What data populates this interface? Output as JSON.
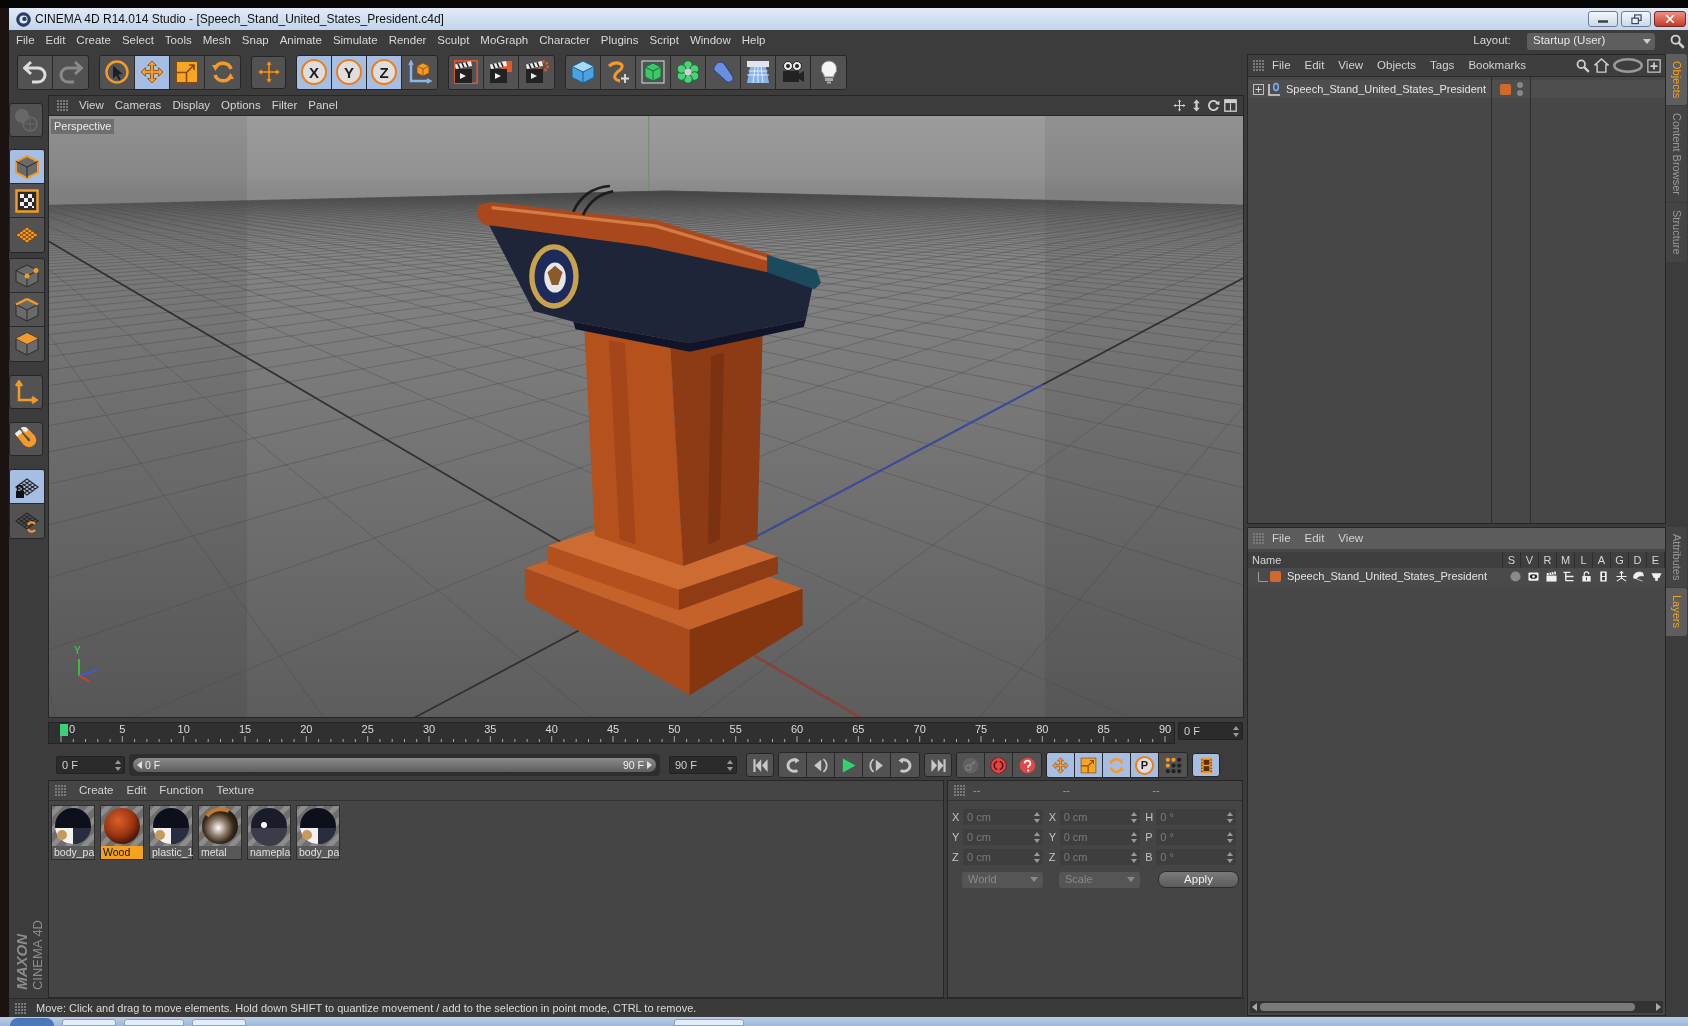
{
  "window": {
    "title": "CINEMA 4D R14.014 Studio - [Speech_Stand_United_States_President.c4d]"
  },
  "menu_bar": {
    "items": [
      "File",
      "Edit",
      "Create",
      "Select",
      "Tools",
      "Mesh",
      "Snap",
      "Animate",
      "Simulate",
      "Render",
      "Sculpt",
      "MoGraph",
      "Character",
      "Plugins",
      "Script",
      "Window",
      "Help"
    ],
    "layout_label": "Layout:",
    "layout_value": "Startup (User)"
  },
  "toolbar": [
    {
      "buttons": [
        {
          "kind": "undo",
          "disabled": false
        },
        {
          "kind": "redo",
          "disabled": true
        }
      ]
    },
    {
      "buttons": [
        {
          "kind": "live_select",
          "selected": false
        },
        {
          "kind": "move",
          "selected": true
        },
        {
          "kind": "scale",
          "selected": false
        },
        {
          "kind": "rotate",
          "selected": false
        }
      ]
    },
    {
      "buttons": [
        {
          "kind": "recent_tool"
        }
      ]
    },
    {
      "buttons": [
        {
          "kind": "axis",
          "label": "X",
          "on": true
        },
        {
          "kind": "axis",
          "label": "Y",
          "on": true
        },
        {
          "kind": "axis",
          "label": "Z",
          "on": true
        },
        {
          "kind": "coordinate_system",
          "on": false
        }
      ]
    },
    {
      "buttons": [
        {
          "kind": "render_view"
        },
        {
          "kind": "render_picture_viewer"
        },
        {
          "kind": "render_settings"
        }
      ]
    },
    {
      "buttons": [
        {
          "kind": "cube"
        },
        {
          "kind": "spline_pen"
        },
        {
          "kind": "subdivision_surface"
        },
        {
          "kind": "cloner"
        },
        {
          "kind": "bend_deformer"
        },
        {
          "kind": "floor"
        },
        {
          "kind": "camera"
        },
        {
          "kind": "light"
        }
      ]
    }
  ],
  "mode_toolbar": [
    {
      "buttons": [
        {
          "kind": "make_editable",
          "disabled": true
        }
      ]
    },
    {
      "buttons": [
        {
          "kind": "model",
          "selected": true
        },
        {
          "kind": "texture",
          "selected": false
        },
        {
          "kind": "workplane",
          "selected": false
        }
      ]
    },
    {
      "buttons": [
        {
          "kind": "points",
          "selected": false
        },
        {
          "kind": "edges",
          "selected": false
        },
        {
          "kind": "polygons",
          "selected": false
        }
      ]
    },
    {
      "buttons": [
        {
          "kind": "axis_mode",
          "selected": false
        }
      ]
    },
    {
      "buttons": [
        {
          "kind": "tweak",
          "selected": false
        }
      ]
    },
    {
      "buttons": [
        {
          "kind": "locked_workplane",
          "on": true
        },
        {
          "kind": "planar_workplane",
          "on": false
        }
      ]
    }
  ],
  "viewport": {
    "menu": [
      "View",
      "Cameras",
      "Display",
      "Options",
      "Filter",
      "Panel"
    ],
    "camera_label": "Perspective",
    "gizmo_label": "Y"
  },
  "timeline": {
    "ruler_labels": [
      "0",
      "5",
      "10",
      "15",
      "20",
      "25",
      "30",
      "35",
      "40",
      "45",
      "50",
      "55",
      "60",
      "65",
      "70",
      "75",
      "80",
      "85",
      "90"
    ],
    "playhead": {
      "level": 0
    },
    "current_frame": "0 F"
  },
  "playback": {
    "start_frame": "0 F",
    "range": {
      "start": "0 F",
      "end": "90 F",
      "level": 1
    },
    "end_frame": "90 F",
    "groups": [
      {
        "buttons": [
          {
            "kind": "to_start"
          }
        ]
      },
      {
        "buttons": [
          {
            "kind": "prev_key"
          },
          {
            "kind": "prev_frame"
          },
          {
            "kind": "play"
          },
          {
            "kind": "next_frame"
          },
          {
            "kind": "next_key"
          }
        ]
      },
      {
        "buttons": [
          {
            "kind": "to_end"
          }
        ]
      },
      {
        "buttons": [
          {
            "kind": "record_keys",
            "disabled": true
          },
          {
            "kind": "autokey",
            "disabled": false
          },
          {
            "kind": "keyframe_selection",
            "disabled": false
          }
        ]
      },
      {
        "buttons": [
          {
            "kind": "key_position",
            "on": true
          },
          {
            "kind": "key_scale",
            "on": true
          },
          {
            "kind": "key_rotation",
            "on": true
          },
          {
            "kind": "key_parameter",
            "label": "P",
            "on": true
          },
          {
            "kind": "key_point_level",
            "on": false
          }
        ]
      },
      {
        "buttons": [
          {
            "kind": "timeline_window",
            "on": true
          }
        ]
      }
    ]
  },
  "materials": {
    "menu": [
      "Create",
      "Edit",
      "Function",
      "Texture"
    ],
    "items": [
      {
        "name": "body_pa",
        "kind": "dark",
        "selected": false
      },
      {
        "name": "Wood",
        "kind": "wood",
        "selected": true
      },
      {
        "name": "plastic_1",
        "kind": "dark",
        "selected": false
      },
      {
        "name": "metal",
        "kind": "metal",
        "selected": false
      },
      {
        "name": "namepla",
        "kind": "glossy",
        "selected": false
      },
      {
        "name": "body_pa",
        "kind": "dark",
        "selected": false
      }
    ]
  },
  "branding": {
    "vendor": "MAXON",
    "product": "CINEMA 4D"
  },
  "coordinates": {
    "disabled": true,
    "columns": [
      {
        "header": "--",
        "fields": [
          {
            "axis": "X",
            "value": "0 cm"
          },
          {
            "axis": "Y",
            "value": "0 cm"
          },
          {
            "axis": "Z",
            "value": "0 cm"
          }
        ]
      },
      {
        "header": "--",
        "fields": [
          {
            "axis": "X",
            "value": "0 cm"
          },
          {
            "axis": "Y",
            "value": "0 cm"
          },
          {
            "axis": "Z",
            "value": "0 cm"
          }
        ]
      },
      {
        "header": "--",
        "fields": [
          {
            "axis": "H",
            "value": "0 °"
          },
          {
            "axis": "P",
            "value": "0 °"
          },
          {
            "axis": "B",
            "value": "0 °"
          }
        ]
      }
    ],
    "space": "World",
    "mode": "Scale",
    "apply_label": "Apply"
  },
  "status_bar": {
    "text": "Move: Click and drag to move elements. Hold down SHIFT to quantize movement / add to the selection in point mode, CTRL to remove."
  },
  "object_manager": {
    "menu": [
      "File",
      "Edit",
      "View",
      "Objects",
      "Tags",
      "Bookmarks"
    ],
    "objects": [
      {
        "name": "Speech_Stand_United_States_President",
        "expanded": false,
        "color": "#d2692a"
      }
    ]
  },
  "layer_manager": {
    "menu": [
      "File",
      "Edit",
      "View"
    ],
    "columns": [
      "Name",
      "S",
      "V",
      "R",
      "M",
      "L",
      "A",
      "G",
      "D",
      "E"
    ],
    "layers": [
      {
        "name": "Speech_Stand_United_States_President",
        "color": "#d2692a",
        "toggles": [
          {
            "kind": "solo",
            "on": false
          },
          {
            "kind": "visible",
            "on": true
          },
          {
            "kind": "render",
            "on": true
          },
          {
            "kind": "manager",
            "on": true
          },
          {
            "kind": "locked",
            "on": true
          },
          {
            "kind": "animation",
            "on": true
          },
          {
            "kind": "generators",
            "on": true
          },
          {
            "kind": "deformers",
            "on": true
          },
          {
            "kind": "expressions",
            "on": true
          }
        ]
      }
    ]
  },
  "side_tabs": [
    {
      "tabs": [
        {
          "label": "Objects",
          "selected": true
        },
        {
          "label": "Content Browser",
          "selected": false
        },
        {
          "label": "Structure",
          "selected": false
        }
      ]
    },
    {
      "tabs": [
        {
          "label": "Attributes",
          "selected": false
        },
        {
          "label": "Layers",
          "selected": true
        }
      ]
    }
  ]
}
